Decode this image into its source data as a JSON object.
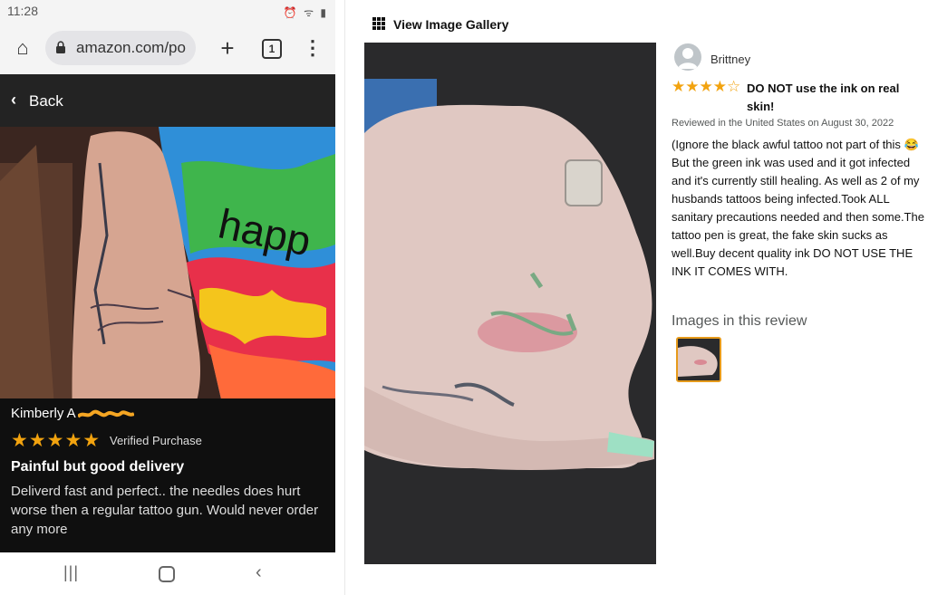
{
  "phone": {
    "status_bar": {
      "time": "11:28",
      "icons": "⏰ ᯤ ▮"
    },
    "browser": {
      "url": "amazon.com/po",
      "tab_count": "1",
      "new_tab_glyph": "+",
      "menu_glyph": "⋮",
      "home_glyph": "⌂"
    },
    "back": {
      "chevron": "‹",
      "label": "Back"
    },
    "review": {
      "reviewer": "Kimberly A",
      "stars": "★★★★★",
      "verified": "Verified Purchase",
      "title": "Painful but good delivery",
      "body": "Deliverd fast and perfect.. the needles does hurt worse then a regular tattoo gun. Would never order any more",
      "photo_text": "happ"
    },
    "nav": {
      "recent_glyph": "|||",
      "back_glyph": "‹"
    }
  },
  "desktop": {
    "gallery_link": "View Image Gallery",
    "review": {
      "reviewer": "Brittney",
      "stars": "★★★★☆",
      "title": "DO NOT use the ink on real skin!",
      "date": "Reviewed in the United States on August 30, 2022",
      "body": "(Ignore the black awful tattoo not part of this 😂But the green ink was used and it got infected and it's currently still healing. As well as 2 of my husbands tattoos being infected.Took ALL sanitary precautions needed and then some.The tattoo pen is great, the fake skin sucks as well.Buy decent quality ink DO NOT USE THE INK IT COMES WITH.",
      "images_heading": "Images in this review"
    }
  },
  "colors": {
    "star": "#f2a30f",
    "thumb_border": "#e69a1b",
    "phone_dark": "#232323"
  }
}
